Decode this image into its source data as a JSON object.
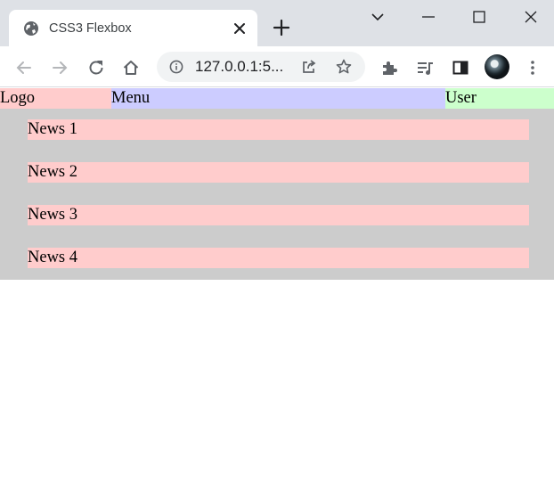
{
  "browser": {
    "tab": {
      "title": "CSS3 Flexbox",
      "favicon": "globe-icon"
    },
    "address_bar": {
      "url": "127.0.0.1:5..."
    },
    "icons": [
      "back-arrow-icon",
      "forward-arrow-icon",
      "reload-icon",
      "home-icon",
      "info-icon",
      "share-icon",
      "star-icon",
      "extensions-icon",
      "media-playlist-icon",
      "side-panel-icon",
      "more-vert-icon"
    ]
  },
  "page": {
    "header": {
      "logo": "Logo",
      "menu": "Menu",
      "user": "User"
    },
    "news": [
      {
        "label": "News 1"
      },
      {
        "label": "News 2"
      },
      {
        "label": "News 3"
      },
      {
        "label": "News 4"
      }
    ]
  },
  "colors": {
    "logo_bg": "#ffcccc",
    "menu_bg": "#ccccff",
    "user_bg": "#ccffcc",
    "main_bg": "#cccccc",
    "news_bg": "#ffcccc",
    "tabstrip_bg": "#dee1e6"
  }
}
